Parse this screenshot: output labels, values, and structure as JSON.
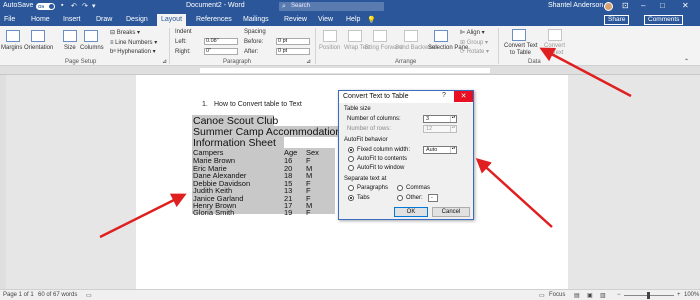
{
  "window": {
    "autosave_label": "AutoSave",
    "autosave_state": "On",
    "title": "Document2 - Word",
    "search_placeholder": "Search",
    "user_name": "Shantel Anderson"
  },
  "tabs": [
    "File",
    "Home",
    "Insert",
    "Draw",
    "Design",
    "Layout",
    "References",
    "Mailings",
    "Review",
    "View",
    "Help"
  ],
  "active_tab": "Layout",
  "share_label": "Share",
  "comments_label": "Comments",
  "ribbon": {
    "page_setup": {
      "margins": "Margins",
      "orientation": "Orientation",
      "size": "Size",
      "columns": "Columns",
      "breaks": "Breaks",
      "line_numbers": "Line Numbers",
      "hyphenation": "Hyphenation",
      "group_label": "Page Setup"
    },
    "paragraph": {
      "indent_label": "Indent",
      "left_label": "Left:",
      "left_value": "0.08\"",
      "right_label": "Right:",
      "right_value": "0\"",
      "spacing_label": "Spacing",
      "before_label": "Before:",
      "before_value": "0 pt",
      "after_label": "After:",
      "after_value": "0 pt",
      "group_label": "Paragraph"
    },
    "arrange": {
      "position": "Position",
      "wrap_text": "Wrap Text",
      "bring_forward": "Bring Forward",
      "send_backward": "Send Backward",
      "selection_pane": "Selection Pane",
      "align": "Align",
      "group": "Group",
      "rotate": "Rotate",
      "group_label": "Arrange"
    },
    "data": {
      "convert_to_table_l1": "Convert Text",
      "convert_to_table_l2": "to Table",
      "convert_to_text_l1": "Convert",
      "convert_to_text_l2": "to Text",
      "group_label": "Data"
    }
  },
  "document": {
    "list_number": "1.",
    "list_item": "How to Convert table to Text",
    "headings": [
      "Canoe Scout Club",
      "Summer Camp Accommodation",
      "Information Sheet"
    ],
    "table_header": [
      "Campers",
      "Age",
      "Sex"
    ],
    "rows": [
      [
        "Marie Brown",
        "16",
        "F"
      ],
      [
        "Eric Marie",
        "20",
        "M"
      ],
      [
        "Dane Alexander",
        "18",
        "M"
      ],
      [
        "Debbie Davidson",
        "15",
        "F"
      ],
      [
        "Judith Keith",
        "13",
        "F"
      ],
      [
        "Janice Garland",
        "21",
        "F"
      ],
      [
        "Henry Brown",
        "17",
        "M"
      ],
      [
        "Gloria Smith",
        "19",
        "F"
      ]
    ]
  },
  "dialog": {
    "title": "Convert Text to Table",
    "help": "?",
    "close": "✕",
    "table_size_label": "Table size",
    "num_columns_label": "Number of columns:",
    "num_columns_value": "3",
    "num_rows_label": "Number of rows:",
    "num_rows_value": "12",
    "autofit_label": "AutoFit behavior",
    "fixed_width_label": "Fixed column width:",
    "fixed_width_value": "Auto",
    "autofit_contents_label": "AutoFit to contents",
    "autofit_window_label": "AutoFit to window",
    "separate_label": "Separate text at",
    "paragraphs_label": "Paragraphs",
    "commas_label": "Commas",
    "tabs_label": "Tabs",
    "other_label": "Other:",
    "other_value": "-",
    "ok_label": "OK",
    "cancel_label": "Cancel"
  },
  "status": {
    "page": "Page 1 of 1",
    "words": "60 of 67 words",
    "focus": "Focus",
    "zoom": "100%"
  },
  "colors": {
    "title_bar": "#2b579a",
    "arrow": "#e02020",
    "selection": "#c8c8c8"
  }
}
